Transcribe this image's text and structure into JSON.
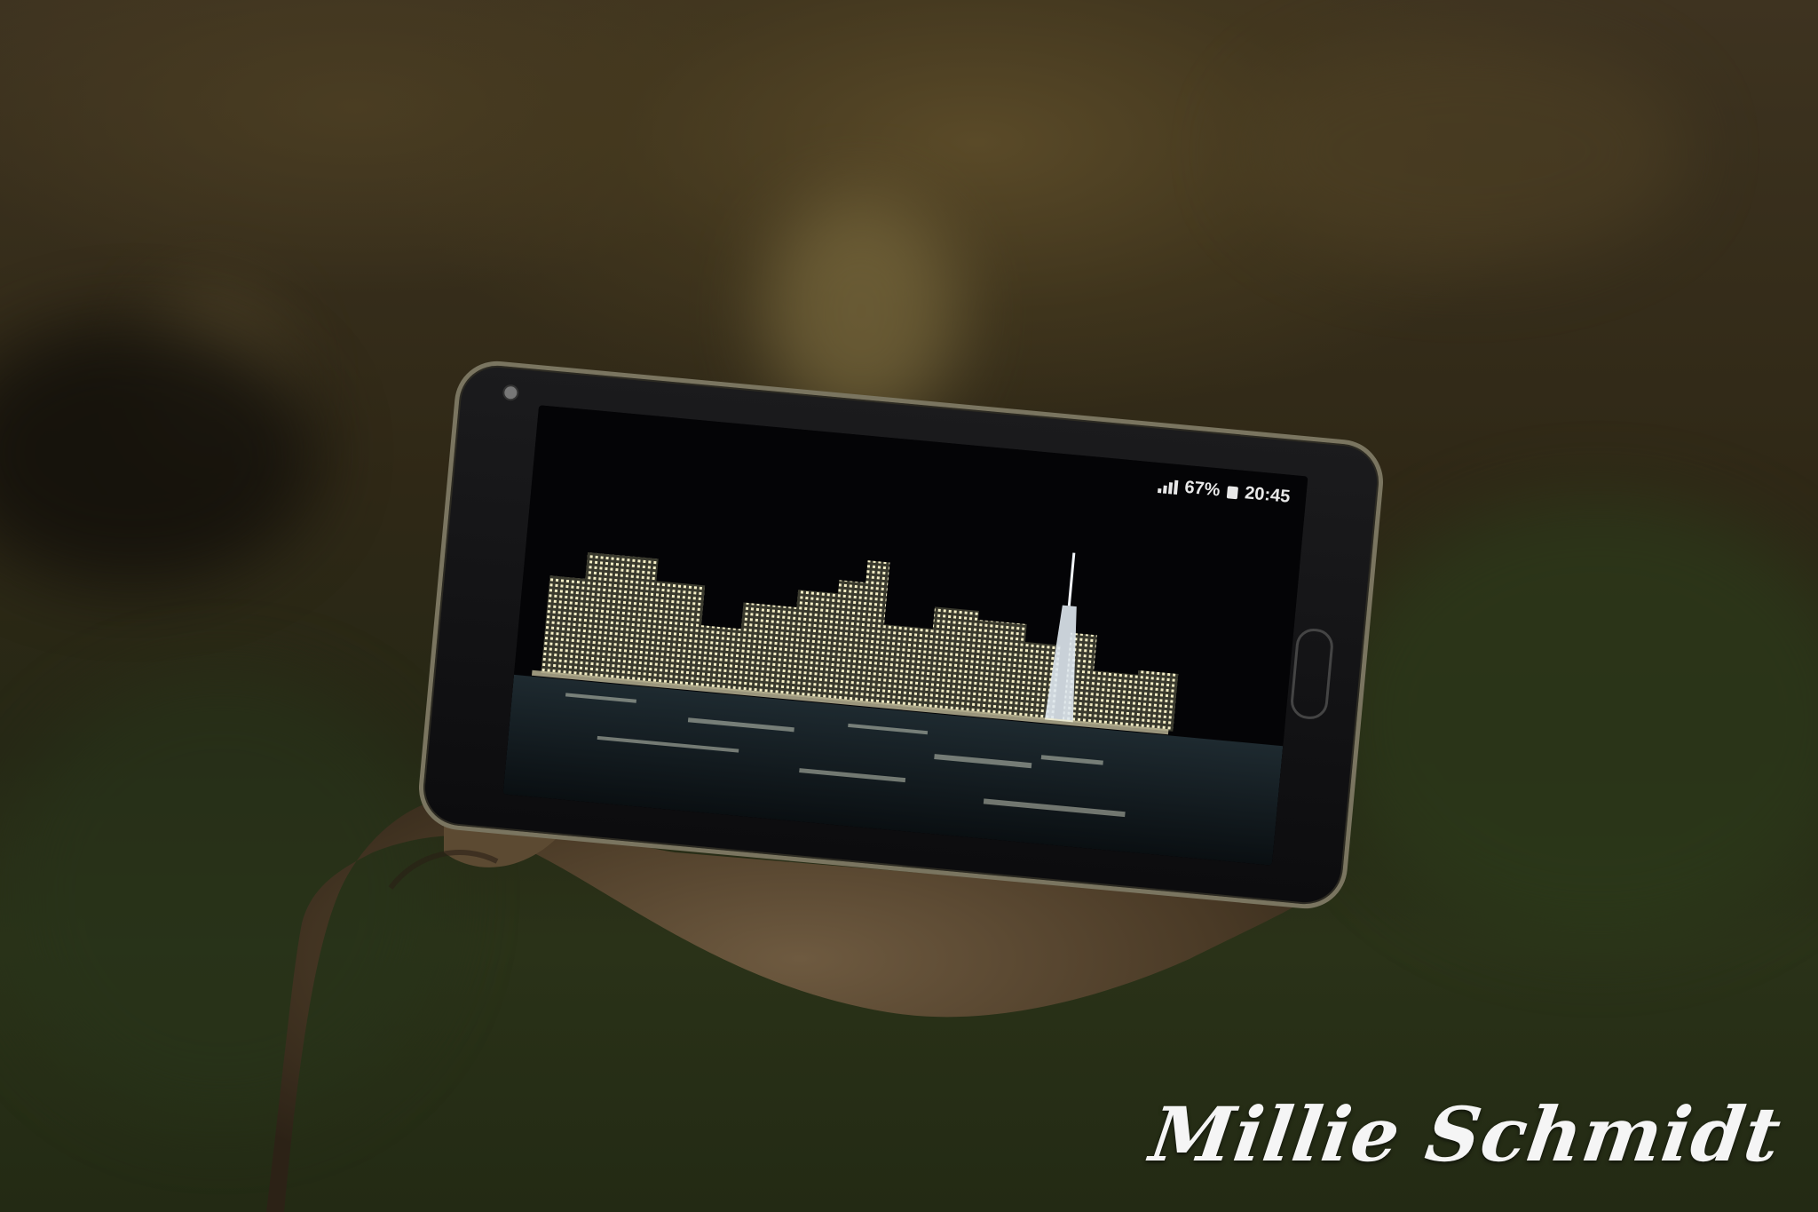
{
  "phone": {
    "status_bar": {
      "battery_percent": "67%",
      "time": "20:45",
      "icons": [
        "signal-icon",
        "battery-icon"
      ]
    },
    "screen_image": "night-city-skyline"
  },
  "watermark": "Millie Schmidt"
}
